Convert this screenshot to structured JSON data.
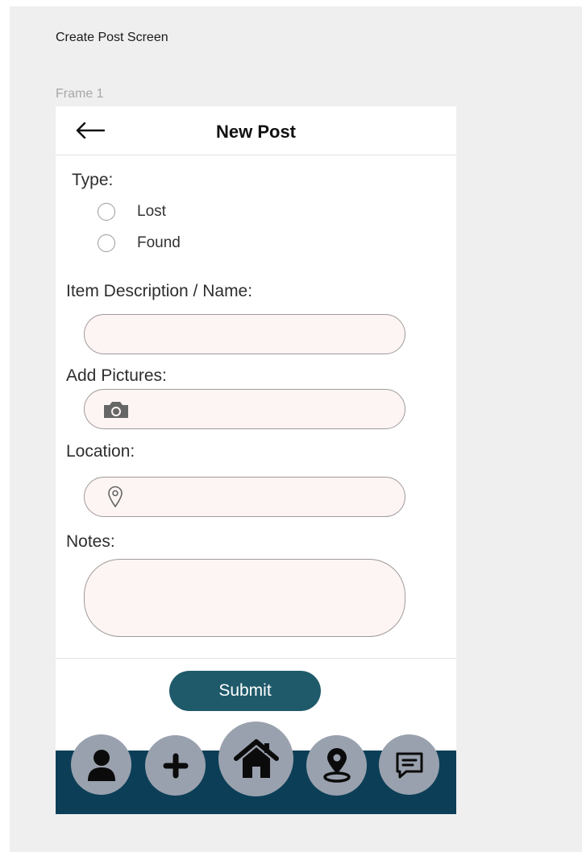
{
  "canvas": {
    "page_title": "Create Post Screen",
    "frame_label": "Frame 1"
  },
  "header": {
    "back_icon": "arrow-left-icon",
    "title": "New Post"
  },
  "form": {
    "type_label": "Type:",
    "type_options": [
      "Lost",
      "Found"
    ],
    "selected_type": null,
    "description_label": "Item Description / Name:",
    "description_value": "",
    "pictures_label": "Add Pictures:",
    "pictures_icon": "camera-icon",
    "location_label": "Location:",
    "location_icon": "map-pin-icon",
    "location_value": "",
    "notes_label": "Notes:",
    "notes_value": "",
    "submit_label": "Submit"
  },
  "bottom_nav": {
    "items": [
      {
        "name": "profile",
        "icon": "user-icon"
      },
      {
        "name": "create-post",
        "icon": "plus-icon"
      },
      {
        "name": "home",
        "icon": "home-icon"
      },
      {
        "name": "map",
        "icon": "location-pin-icon"
      },
      {
        "name": "messages",
        "icon": "chat-icon"
      }
    ]
  },
  "colors": {
    "primary": "#1f5a6a",
    "navbar": "#0c3f57",
    "nav_button": "#9aa1ae",
    "field_fill": "#fdf5f4",
    "canvas_bg": "#efefef"
  }
}
